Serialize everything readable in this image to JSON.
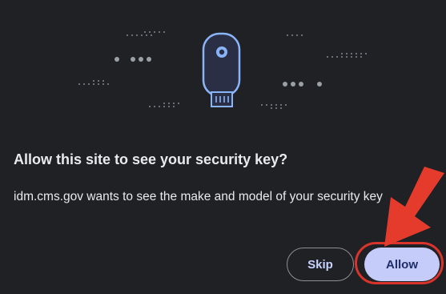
{
  "dialog": {
    "title": "Allow this site to see your security key?",
    "body": "idm.cms.gov wants to see the make and model of your security key"
  },
  "buttons": {
    "skip_label": "Skip",
    "allow_label": "Allow"
  },
  "illustration": {
    "icon": "security-key-icon"
  },
  "colors": {
    "background": "#202124",
    "accent": "#c5ccf9",
    "key_outline": "#8ab4f8",
    "annotation_red": "#d9332b"
  }
}
